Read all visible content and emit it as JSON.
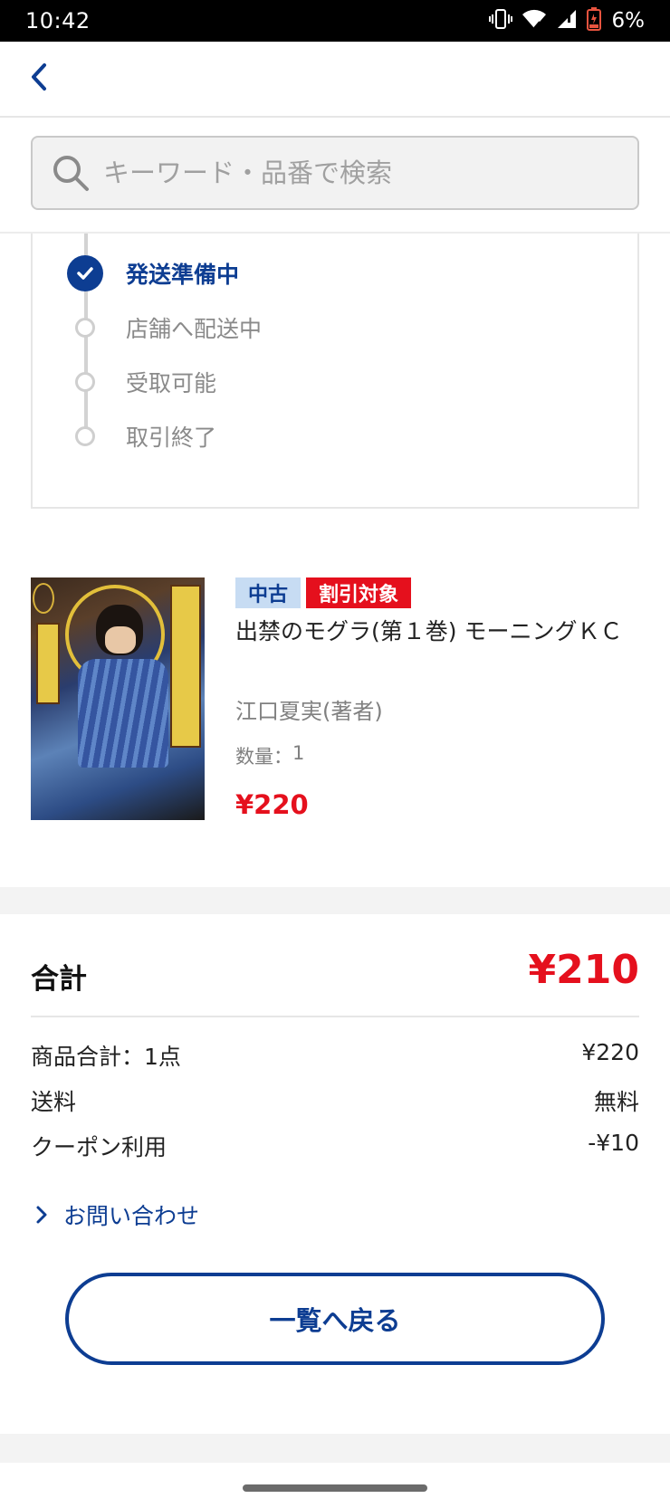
{
  "status_bar": {
    "time": "10:42",
    "battery": "6%",
    "icons": [
      "vibrate-icon",
      "wifi-icon",
      "signal-icon",
      "battery-charging-icon"
    ]
  },
  "search": {
    "placeholder": "キーワード・品番で検索"
  },
  "order_status": {
    "steps": [
      {
        "label": "発送準備中",
        "state": "done"
      },
      {
        "label": "店舗へ配送中",
        "state": "pending"
      },
      {
        "label": "受取可能",
        "state": "pending"
      },
      {
        "label": "取引終了",
        "state": "pending"
      }
    ]
  },
  "product": {
    "badges": [
      "中古",
      "割引対象"
    ],
    "title": "出禁のモグラ(第１巻) モーニングＫＣ",
    "author": "江口夏実(著者)",
    "quantity_label": "数量：",
    "quantity": "1",
    "price": "¥220"
  },
  "summary": {
    "total_label": "合計",
    "total_value": "¥210",
    "rows": [
      {
        "label": "商品合計：1点",
        "value": "¥220"
      },
      {
        "label": "送料",
        "value": "無料"
      },
      {
        "label": "クーポン利用",
        "value": "-¥10"
      }
    ]
  },
  "contact_link": "お問い合わせ",
  "back_button": "一覧へ戻る",
  "colors": {
    "brand_blue": "#0d3d92",
    "price_red": "#e5101d",
    "used_badge_bg": "#c7dcf3"
  }
}
